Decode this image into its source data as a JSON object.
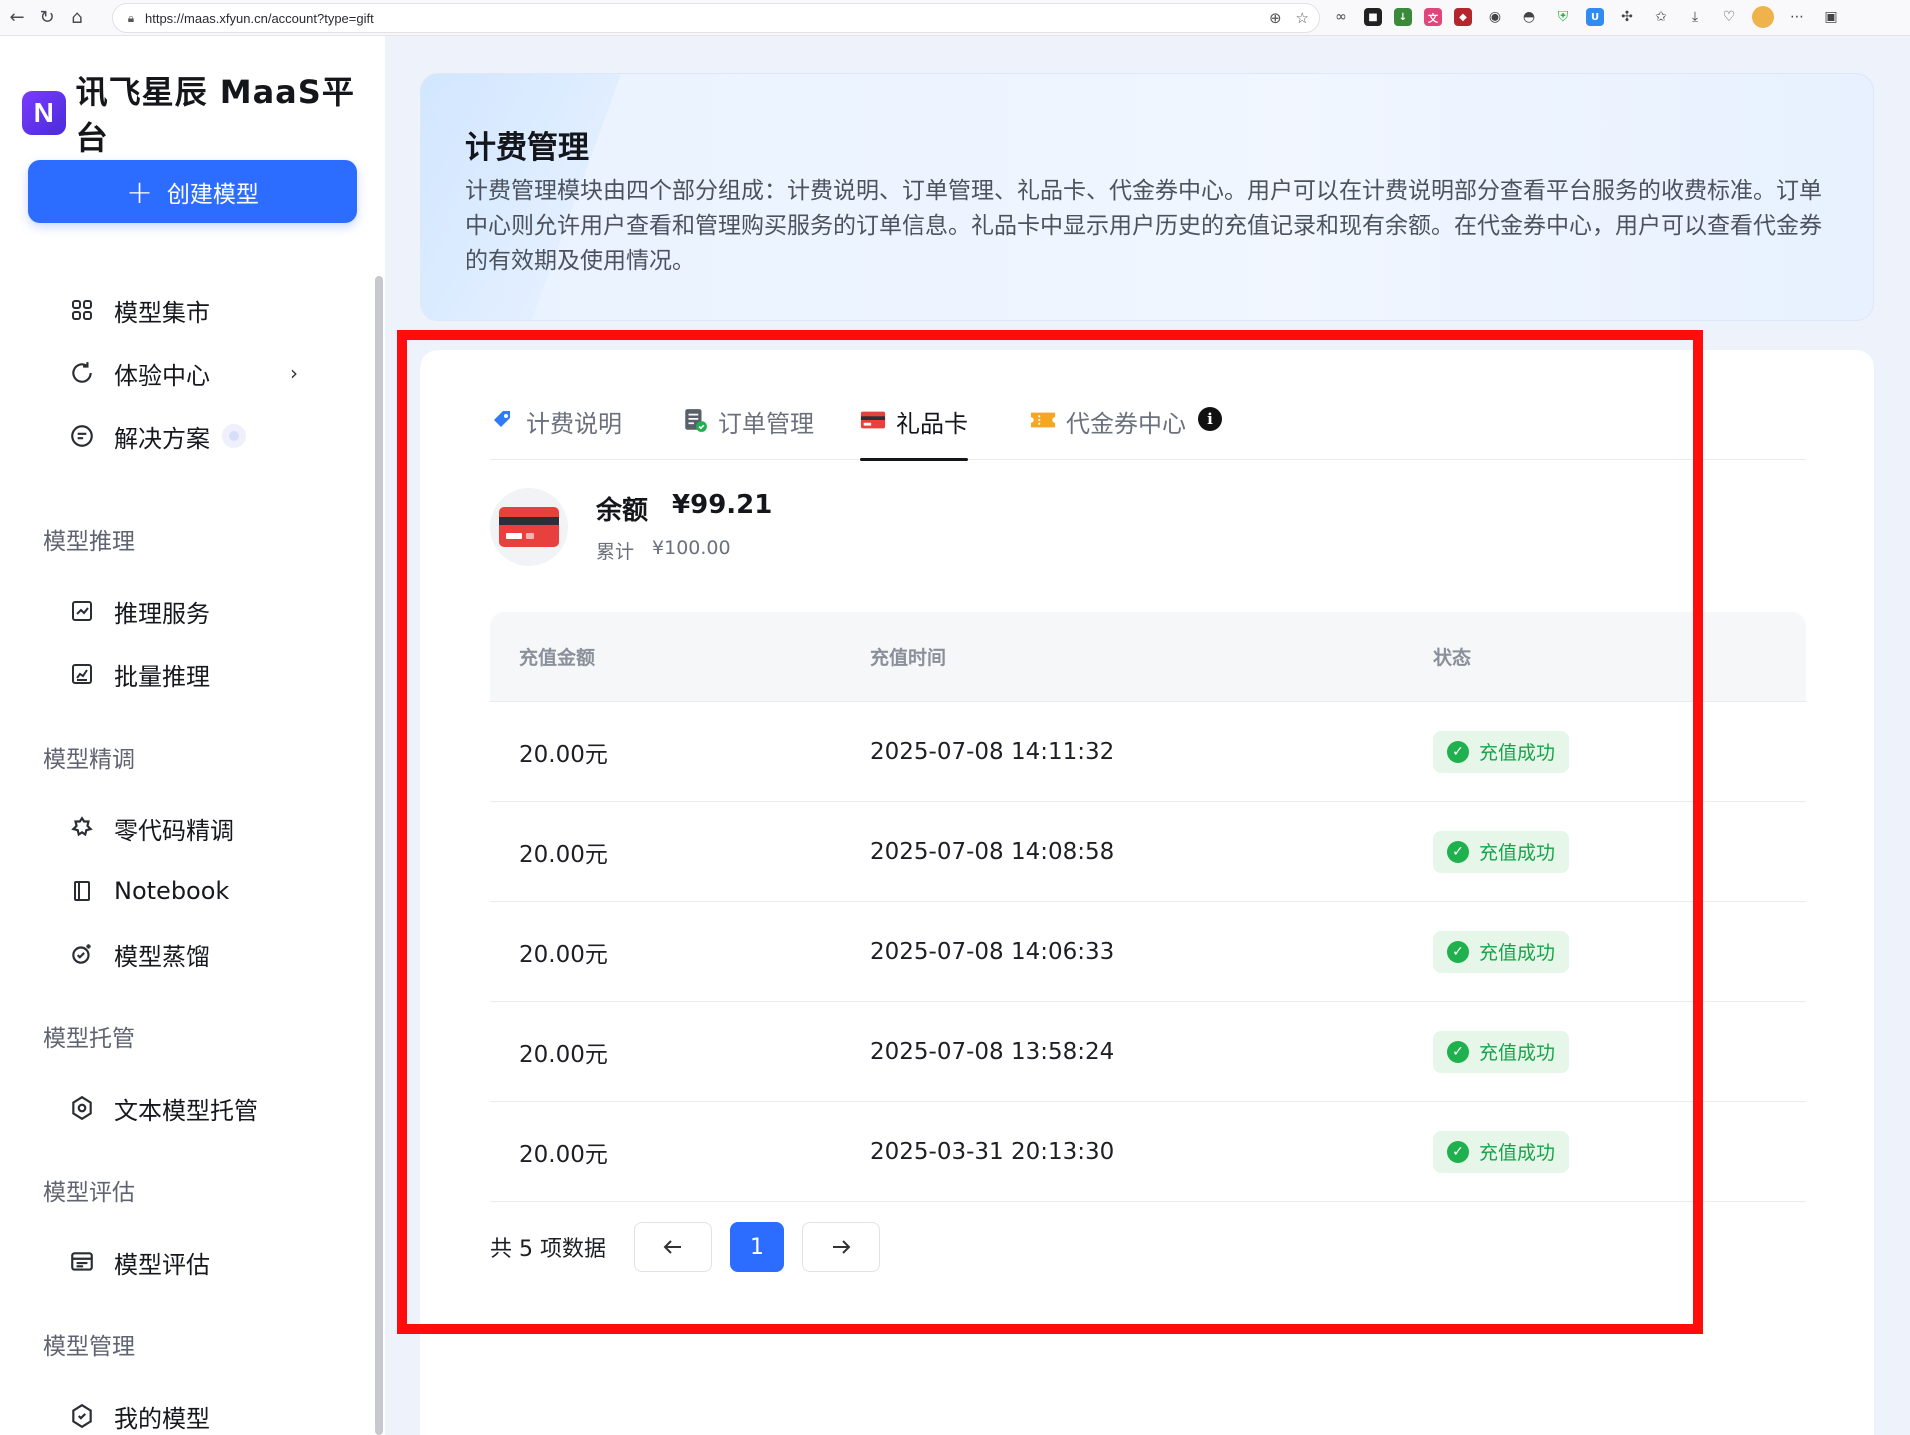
{
  "browser": {
    "url": "https://maas.xfyun.cn/account?type=gift"
  },
  "sidebar": {
    "logo_text": "讯飞星辰 MaaS平台",
    "create_button": "创建模型",
    "items_top": [
      {
        "label": "模型集市",
        "icon": "grid-icon"
      },
      {
        "label": "体验中心",
        "icon": "refresh-icon"
      },
      {
        "label": "解决方案",
        "icon": "solution-icon"
      }
    ],
    "groups": [
      {
        "title": "模型推理",
        "items": [
          "推理服务",
          "批量推理"
        ]
      },
      {
        "title": "模型精调",
        "items": [
          "零代码精调",
          "Notebook",
          "模型蒸馏"
        ]
      },
      {
        "title": "模型托管",
        "items": [
          "文本模型托管"
        ]
      },
      {
        "title": "模型评估",
        "items": [
          "模型评估"
        ]
      },
      {
        "title": "模型管理",
        "items": [
          "我的模型"
        ]
      }
    ]
  },
  "header": {
    "title": "计费管理",
    "description": "计费管理模块由四个部分组成：计费说明、订单管理、礼品卡、代金券中心。用户可以在计费说明部分查看平台服务的收费标准。订单中心则允许用户查看和管理购买服务的订单信息。礼品卡中显示用户历史的充值记录和现有余额。在代金券中心，用户可以查看代金券的有效期及使用情况。"
  },
  "tabs": [
    {
      "label": "计费说明",
      "icon": "tag-icon",
      "active": false
    },
    {
      "label": "订单管理",
      "icon": "order-icon",
      "active": false
    },
    {
      "label": "礼品卡",
      "icon": "card-icon",
      "active": true
    },
    {
      "label": "代金券中心",
      "icon": "ticket-icon",
      "active": false
    }
  ],
  "balance": {
    "label": "余额",
    "amount": "¥99.21",
    "total_label": "累计",
    "total": "¥100.00"
  },
  "table": {
    "headers": [
      "充值金额",
      "充值时间",
      "状态"
    ],
    "rows": [
      {
        "amount": "20.00元",
        "time": "2025-07-08 14:11:32",
        "status": "充值成功"
      },
      {
        "amount": "20.00元",
        "time": "2025-07-08 14:08:58",
        "status": "充值成功"
      },
      {
        "amount": "20.00元",
        "time": "2025-07-08 14:06:33",
        "status": "充值成功"
      },
      {
        "amount": "20.00元",
        "time": "2025-07-08 13:58:24",
        "status": "充值成功"
      },
      {
        "amount": "20.00元",
        "time": "2025-03-31 20:13:30",
        "status": "充值成功"
      }
    ]
  },
  "pagination": {
    "total_text": "共 5 项数据",
    "current_page": "1"
  },
  "colors": {
    "accent": "#2c6cff",
    "success": "#17a34a",
    "highlight": "#ff0d0d"
  }
}
